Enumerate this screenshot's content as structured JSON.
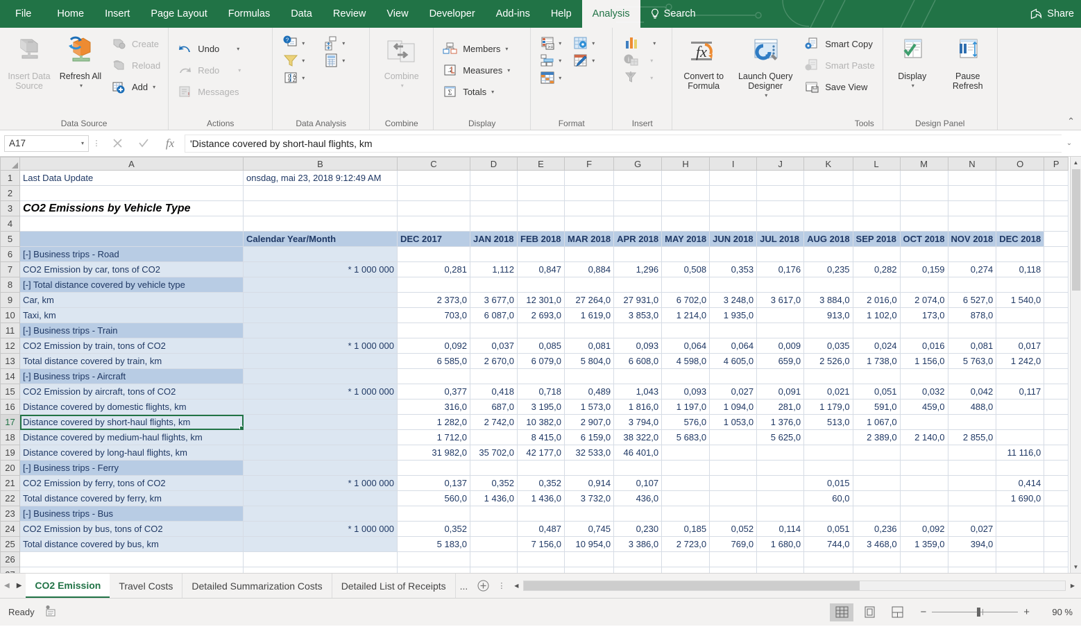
{
  "ribbon": {
    "tabs": [
      {
        "label": "File",
        "active": false
      },
      {
        "label": "Home",
        "active": false
      },
      {
        "label": "Insert",
        "active": false
      },
      {
        "label": "Page Layout",
        "active": false
      },
      {
        "label": "Formulas",
        "active": false
      },
      {
        "label": "Data",
        "active": false
      },
      {
        "label": "Review",
        "active": false
      },
      {
        "label": "View",
        "active": false
      },
      {
        "label": "Developer",
        "active": false
      },
      {
        "label": "Add-ins",
        "active": false
      },
      {
        "label": "Help",
        "active": false
      },
      {
        "label": "Analysis",
        "active": true
      }
    ],
    "search_label": "Search",
    "share_label": "Share",
    "collapse_icon": "chevron-up-icon",
    "groups": [
      {
        "label": "Data Source",
        "big": [
          {
            "label": "Insert Data Source",
            "icon": "insert-data-source-icon",
            "disabled": true,
            "dropdown": true
          },
          {
            "label": "Refresh All",
            "icon": "refresh-all-icon",
            "disabled": false,
            "dropdown": true
          }
        ],
        "small": [
          {
            "label": "Create",
            "icon": "create-icon",
            "disabled": true,
            "dropdown": false
          },
          {
            "label": "Reload",
            "icon": "reload-icon",
            "disabled": true,
            "dropdown": false
          },
          {
            "label": "Add",
            "icon": "add-icon",
            "disabled": false,
            "dropdown": true
          }
        ]
      },
      {
        "label": "Actions",
        "small": [
          {
            "label": "Undo",
            "icon": "undo-icon",
            "disabled": false,
            "dropdown": true
          },
          {
            "label": "Redo",
            "icon": "redo-icon",
            "disabled": true,
            "dropdown": true
          },
          {
            "label": "Messages",
            "icon": "messages-icon",
            "disabled": true,
            "dropdown": false
          }
        ]
      },
      {
        "label": "Data Analysis",
        "iconrows": [
          [
            {
              "icon": "prompts-icon",
              "dropdown": true
            },
            {
              "icon": "hierarchy-icon",
              "dropdown": true
            }
          ],
          [
            {
              "icon": "filter-icon",
              "dropdown": true
            },
            {
              "icon": "calculations-icon",
              "dropdown": true
            }
          ],
          [
            {
              "icon": "sort-icon",
              "dropdown": true
            }
          ]
        ]
      },
      {
        "label": "Combine",
        "big": [
          {
            "label": "Combine",
            "icon": "combine-icon",
            "disabled": true,
            "dropdown": true
          }
        ]
      },
      {
        "label": "Display",
        "small": [
          {
            "label": "Members",
            "icon": "members-icon",
            "disabled": false,
            "dropdown": true
          },
          {
            "label": "Measures",
            "icon": "measures-icon",
            "disabled": false,
            "dropdown": true
          },
          {
            "label": "Totals",
            "icon": "totals-icon",
            "disabled": false,
            "dropdown": true
          }
        ]
      },
      {
        "label": "Format",
        "iconrows": [
          [
            {
              "icon": "conditional-format-icon",
              "dropdown": true
            },
            {
              "icon": "styles-icon",
              "dropdown": true
            }
          ],
          [
            {
              "icon": "indent-icon",
              "dropdown": true
            },
            {
              "icon": "highlight-icon",
              "dropdown": true
            }
          ],
          [
            {
              "icon": "table-design-icon",
              "dropdown": true
            }
          ]
        ]
      },
      {
        "label": "Insert",
        "iconrows": [
          [
            {
              "icon": "chart-icon",
              "dropdown": true,
              "disabled": false
            }
          ],
          [
            {
              "icon": "info-field-icon",
              "dropdown": true,
              "disabled": true
            }
          ],
          [
            {
              "icon": "insert-filter-icon",
              "dropdown": true,
              "disabled": true
            }
          ]
        ]
      },
      {
        "label": "Tools",
        "big": [
          {
            "label": "Convert to Formula",
            "icon": "convert-to-formula-icon",
            "disabled": false,
            "dropdown": false
          },
          {
            "label": "Launch Query Designer",
            "icon": "launch-query-designer-icon",
            "disabled": false,
            "dropdown": true
          }
        ],
        "small": [
          {
            "label": "Smart Copy",
            "icon": "smart-copy-icon",
            "disabled": false,
            "dropdown": false
          },
          {
            "label": "Smart Paste",
            "icon": "smart-paste-icon",
            "disabled": true,
            "dropdown": false
          },
          {
            "label": "Save View",
            "icon": "save-view-icon",
            "disabled": false,
            "dropdown": false
          }
        ]
      },
      {
        "label": "Design Panel",
        "big": [
          {
            "label": "Display",
            "icon": "display-panel-icon",
            "disabled": false,
            "dropdown": true
          },
          {
            "label": "Pause Refresh",
            "icon": "pause-refresh-icon",
            "disabled": false,
            "dropdown": false
          }
        ]
      }
    ]
  },
  "formula_bar": {
    "name_box_value": "A17",
    "cancel_icon": "close-icon",
    "confirm_icon": "check-icon",
    "fx_icon": "fx-icon",
    "formula_value": "'Distance covered by short-haul flights, km",
    "expand_icon": "chevron-down-icon"
  },
  "grid": {
    "columns": [
      "A",
      "B",
      "C",
      "D",
      "E",
      "F",
      "G",
      "H",
      "I",
      "J",
      "K",
      "L",
      "M",
      "N",
      "O",
      "P"
    ],
    "row_numbers": [
      "1",
      "2",
      "3",
      "4",
      "5",
      "6",
      "7",
      "8",
      "9",
      "10",
      "11",
      "12",
      "13",
      "14",
      "15",
      "16",
      "17",
      "18",
      "19",
      "20",
      "21",
      "22",
      "23",
      "24",
      "25",
      "26",
      "27"
    ],
    "selected_cell": "A17",
    "cells": {
      "r1": {
        "A": "Last Data Update",
        "B": "onsdag, mai 23, 2018 9:12:49 AM"
      },
      "r3": {
        "A": "CO2 Emissions by Vehicle Type"
      },
      "r5": {
        "B": "Calendar Year/Month",
        "months": [
          "DEC 2017",
          "JAN 2018",
          "FEB 2018",
          "MAR 2018",
          "APR 2018",
          "MAY 2018",
          "JUN 2018",
          "JUL 2018",
          "AUG 2018",
          "SEP 2018",
          "OCT 2018",
          "NOV 2018",
          "DEC 2018"
        ]
      }
    },
    "factor_label": "* 1 000 000",
    "rows": [
      {
        "n": 6,
        "label": "[-] Business trips - Road",
        "indent": 0,
        "type": "group",
        "factor": "",
        "values": [
          "",
          "",
          "",
          "",
          "",
          "",
          "",
          "",
          "",
          "",
          "",
          "",
          ""
        ]
      },
      {
        "n": 7,
        "label": "CO2 Emission by car, tons of CO2",
        "indent": 1,
        "type": "data",
        "factor": "* 1 000 000",
        "values": [
          "0,281",
          "1,112",
          "0,847",
          "0,884",
          "1,296",
          "0,508",
          "0,353",
          "0,176",
          "0,235",
          "0,282",
          "0,159",
          "0,274",
          "0,118"
        ]
      },
      {
        "n": 8,
        "label": "[-] Total distance covered by vehicle type",
        "indent": 2,
        "type": "group",
        "factor": "",
        "values": [
          "",
          "",
          "",
          "",
          "",
          "",
          "",
          "",
          "",
          "",
          "",
          "",
          ""
        ]
      },
      {
        "n": 9,
        "label": "Car, km",
        "indent": 3,
        "type": "data",
        "factor": "",
        "values": [
          "2 373,0",
          "3 677,0",
          "12 301,0",
          "27 264,0",
          "27 931,0",
          "6 702,0",
          "3 248,0",
          "3 617,0",
          "3 884,0",
          "2 016,0",
          "2 074,0",
          "6 527,0",
          "1 540,0"
        ]
      },
      {
        "n": 10,
        "label": "Taxi, km",
        "indent": 3,
        "type": "data",
        "factor": "",
        "values": [
          "703,0",
          "6 087,0",
          "2 693,0",
          "1 619,0",
          "3 853,0",
          "1 214,0",
          "1 935,0",
          "",
          "913,0",
          "1 102,0",
          "173,0",
          "878,0",
          ""
        ]
      },
      {
        "n": 11,
        "label": "[-] Business trips - Train",
        "indent": 0,
        "type": "group",
        "factor": "",
        "values": [
          "",
          "",
          "",
          "",
          "",
          "",
          "",
          "",
          "",
          "",
          "",
          "",
          ""
        ]
      },
      {
        "n": 12,
        "label": "CO2 Emission by train, tons of CO2",
        "indent": 1,
        "type": "data",
        "factor": "* 1 000 000",
        "values": [
          "0,092",
          "0,037",
          "0,085",
          "0,081",
          "0,093",
          "0,064",
          "0,064",
          "0,009",
          "0,035",
          "0,024",
          "0,016",
          "0,081",
          "0,017"
        ]
      },
      {
        "n": 13,
        "label": "Total distance covered by train, km",
        "indent": 1,
        "type": "data",
        "factor": "",
        "values": [
          "6 585,0",
          "2 670,0",
          "6 079,0",
          "5 804,0",
          "6 608,0",
          "4 598,0",
          "4 605,0",
          "659,0",
          "2 526,0",
          "1 738,0",
          "1 156,0",
          "5 763,0",
          "1 242,0"
        ]
      },
      {
        "n": 14,
        "label": "[-] Business trips - Aircraft",
        "indent": 0,
        "type": "group",
        "factor": "",
        "values": [
          "",
          "",
          "",
          "",
          "",
          "",
          "",
          "",
          "",
          "",
          "",
          "",
          ""
        ]
      },
      {
        "n": 15,
        "label": "CO2 Emission by aircraft, tons of CO2",
        "indent": 1,
        "type": "data",
        "factor": "* 1 000 000",
        "values": [
          "0,377",
          "0,418",
          "0,718",
          "0,489",
          "1,043",
          "0,093",
          "0,027",
          "0,091",
          "0,021",
          "0,051",
          "0,032",
          "0,042",
          "0,117"
        ]
      },
      {
        "n": 16,
        "label": "Distance covered by domestic flights, km",
        "indent": 1,
        "type": "data",
        "factor": "",
        "values": [
          "316,0",
          "687,0",
          "3 195,0",
          "1 573,0",
          "1 816,0",
          "1 197,0",
          "1 094,0",
          "281,0",
          "1 179,0",
          "591,0",
          "459,0",
          "488,0",
          ""
        ]
      },
      {
        "n": 17,
        "label": "Distance covered by short-haul flights, km",
        "indent": 1,
        "type": "data",
        "factor": "",
        "selected": true,
        "values": [
          "1 282,0",
          "2 742,0",
          "10 382,0",
          "2 907,0",
          "3 794,0",
          "576,0",
          "1 053,0",
          "1 376,0",
          "513,0",
          "1 067,0",
          "",
          "",
          ""
        ]
      },
      {
        "n": 18,
        "label": "Distance covered by medium-haul flights, km",
        "indent": 1,
        "type": "data",
        "factor": "",
        "values": [
          "1 712,0",
          "",
          "8 415,0",
          "6 159,0",
          "38 322,0",
          "5 683,0",
          "",
          "5 625,0",
          "",
          "2 389,0",
          "2 140,0",
          "2 855,0",
          ""
        ]
      },
      {
        "n": 19,
        "label": "Distance covered by long-haul flights, km",
        "indent": 1,
        "type": "data",
        "factor": "",
        "values": [
          "31 982,0",
          "35 702,0",
          "42 177,0",
          "32 533,0",
          "46 401,0",
          "",
          "",
          "",
          "",
          "",
          "",
          "",
          "11 116,0"
        ]
      },
      {
        "n": 20,
        "label": "[-] Business trips - Ferry",
        "indent": 0,
        "type": "group",
        "factor": "",
        "values": [
          "",
          "",
          "",
          "",
          "",
          "",
          "",
          "",
          "",
          "",
          "",
          "",
          ""
        ]
      },
      {
        "n": 21,
        "label": "CO2 Emission by ferry, tons of CO2",
        "indent": 1,
        "type": "data",
        "factor": "* 1 000 000",
        "values": [
          "0,137",
          "0,352",
          "0,352",
          "0,914",
          "0,107",
          "",
          "",
          "",
          "0,015",
          "",
          "",
          "",
          "0,414"
        ]
      },
      {
        "n": 22,
        "label": "Total distance covered by ferry, km",
        "indent": 1,
        "type": "data",
        "factor": "",
        "values": [
          "560,0",
          "1 436,0",
          "1 436,0",
          "3 732,0",
          "436,0",
          "",
          "",
          "",
          "60,0",
          "",
          "",
          "",
          "1 690,0"
        ]
      },
      {
        "n": 23,
        "label": "[-] Business trips - Bus",
        "indent": 0,
        "type": "group",
        "factor": "",
        "values": [
          "",
          "",
          "",
          "",
          "",
          "",
          "",
          "",
          "",
          "",
          "",
          "",
          ""
        ]
      },
      {
        "n": 24,
        "label": "CO2 Emission by bus, tons of CO2",
        "indent": 1,
        "type": "data",
        "factor": "* 1 000 000",
        "values": [
          "0,352",
          "",
          "0,487",
          "0,745",
          "0,230",
          "0,185",
          "0,052",
          "0,114",
          "0,051",
          "0,236",
          "0,092",
          "0,027",
          ""
        ]
      },
      {
        "n": 25,
        "label": "Total distance covered by bus, km",
        "indent": 1,
        "type": "data",
        "factor": "",
        "values": [
          "5 183,0",
          "",
          "7 156,0",
          "10 954,0",
          "3 386,0",
          "2 723,0",
          "769,0",
          "1 680,0",
          "744,0",
          "3 468,0",
          "1 359,0",
          "394,0",
          ""
        ]
      }
    ]
  },
  "sheet_tabs": {
    "prev_icon": "chevron-left-icon",
    "next_icon": "chevron-right-icon",
    "tabs": [
      {
        "label": "CO2 Emission",
        "active": true
      },
      {
        "label": "Travel Costs",
        "active": false
      },
      {
        "label": "Detailed Summarization Costs",
        "active": false
      },
      {
        "label": "Detailed List of Receipts",
        "active": false
      }
    ],
    "overflow_label": "...",
    "add_sheet_icon": "plus-circle-icon",
    "menu_icon": "more-vertical-icon"
  },
  "status_bar": {
    "status_text": "Ready",
    "accessibility_icon": "accessibility-icon",
    "views": [
      {
        "name": "normal-view",
        "icon": "grid-view-icon",
        "active": true
      },
      {
        "name": "page-layout-view",
        "icon": "page-layout-icon",
        "active": false
      },
      {
        "name": "page-break-view",
        "icon": "page-break-icon",
        "active": false
      }
    ],
    "zoom_out_label": "−",
    "zoom_in_label": "+",
    "zoom_level": "90 %"
  },
  "colors": {
    "brand_green": "#217346",
    "header_fill": "#b8cce4",
    "data_fill": "#dce6f1",
    "text_blue": "#1f3864"
  }
}
